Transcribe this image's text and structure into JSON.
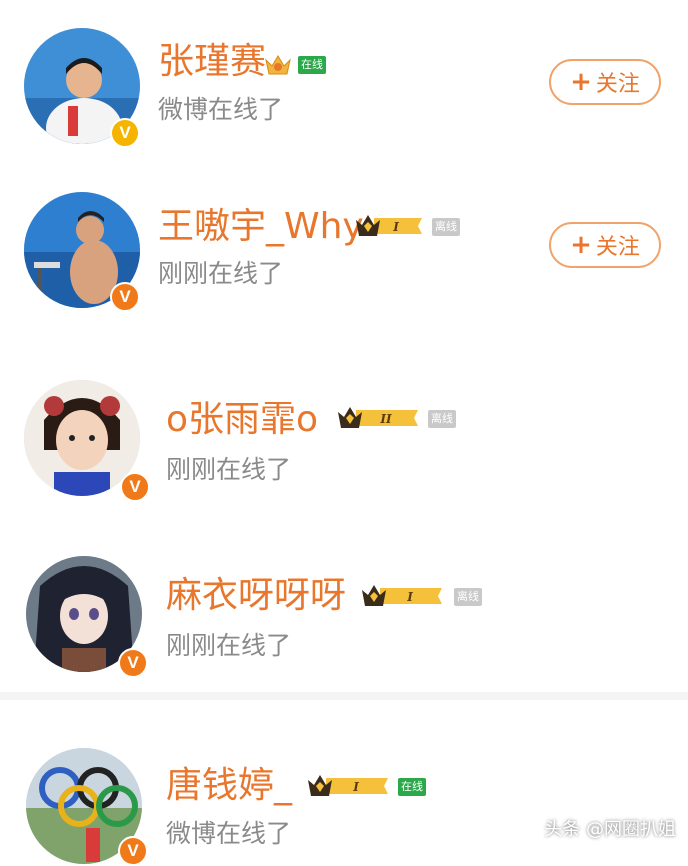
{
  "users": [
    {
      "name": "张瑾赛",
      "status": "微博在线了",
      "presence": "在线",
      "follow_label": "关注"
    },
    {
      "name": "王嗷宇_Why",
      "status": "刚刚在线了",
      "presence": "离线",
      "follow_label": "关注",
      "level": "I"
    },
    {
      "name": "o张雨霏o",
      "status": "刚刚在线了",
      "presence": "离线",
      "level": "II"
    },
    {
      "name": "麻衣呀呀呀",
      "status": "刚刚在线了",
      "presence": "离线",
      "level": "I"
    },
    {
      "name": "唐钱婷_",
      "status": "微博在线了",
      "presence": "在线",
      "level": "I"
    }
  ],
  "verified_mark": "V",
  "watermark": "头条 @网圈扒姐",
  "colors": {
    "name": "#e8772d",
    "status": "#8a8a8a",
    "online": "#2ba84a",
    "offline": "#c9c9c9",
    "verified_gold": "#f5b400",
    "verified_orange": "#f07a1a"
  }
}
